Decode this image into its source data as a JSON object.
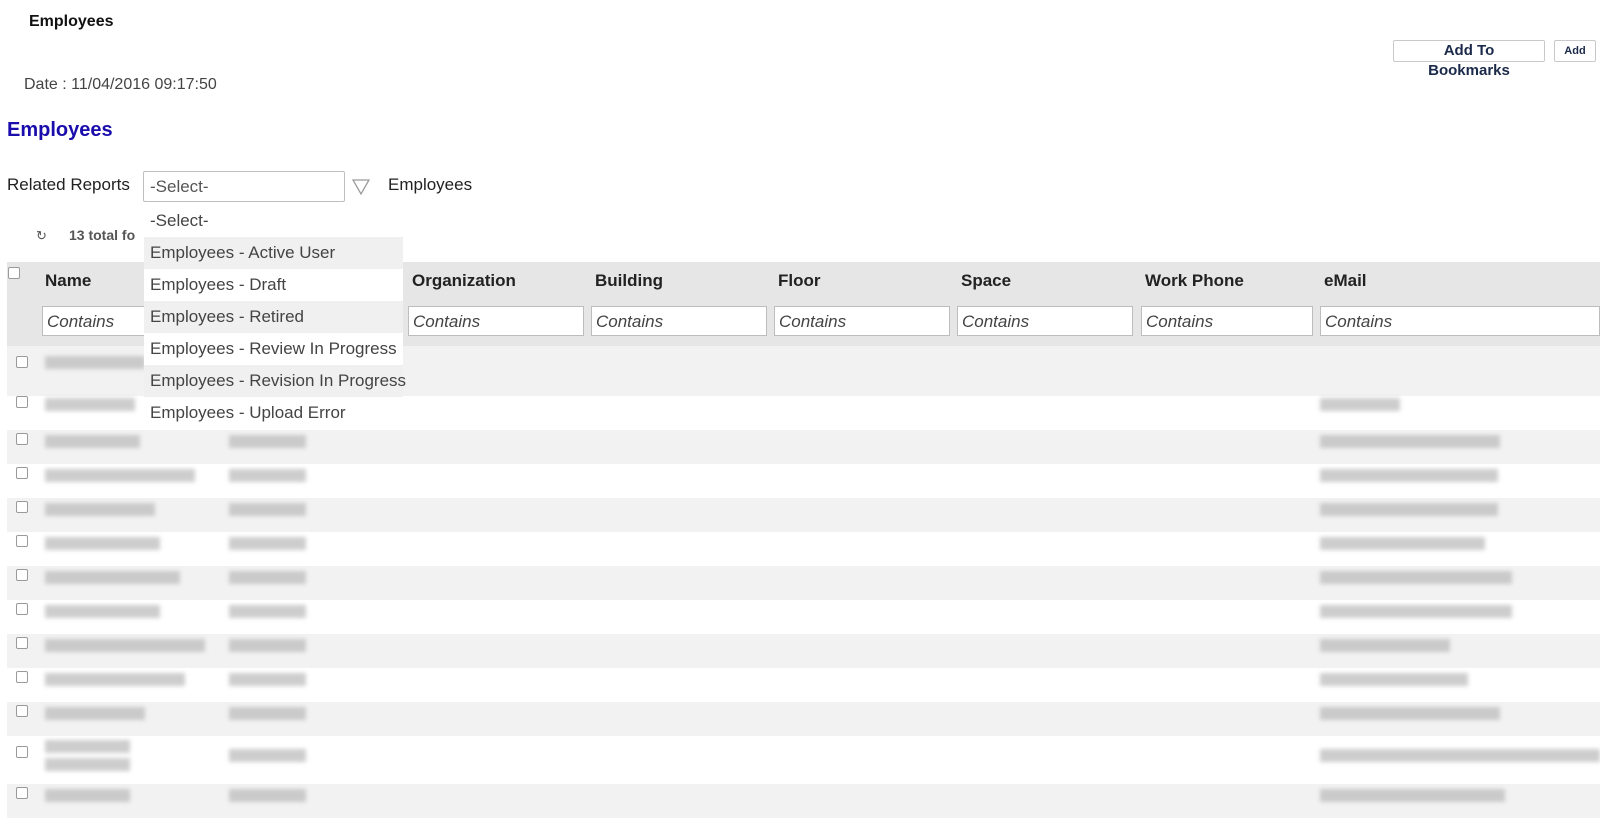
{
  "page": {
    "title": "Employees"
  },
  "toolbar": {
    "bookmark_label": "Add To Bookmarks",
    "add_label": "Add"
  },
  "report": {
    "date_line": "Date : 11/04/2016 09:17:50",
    "title": "Employees"
  },
  "related": {
    "label": "Related Reports",
    "selected": "-Select-",
    "current": "Employees",
    "options": [
      "-Select-",
      "Employees - Active User",
      "Employees - Draft",
      "Employees - Retired",
      "Employees - Review In Progress",
      "Employees - Revision In Progress",
      "Employees - Upload Error"
    ]
  },
  "results": {
    "total_text": "13 total fo"
  },
  "grid": {
    "columns": [
      "Name",
      "Organization",
      "Building",
      "Floor",
      "Space",
      "Work Phone",
      "eMail"
    ],
    "filter_placeholder": "Contains"
  },
  "icons": {
    "filter": "filter-icon",
    "refresh": "refresh-icon"
  }
}
